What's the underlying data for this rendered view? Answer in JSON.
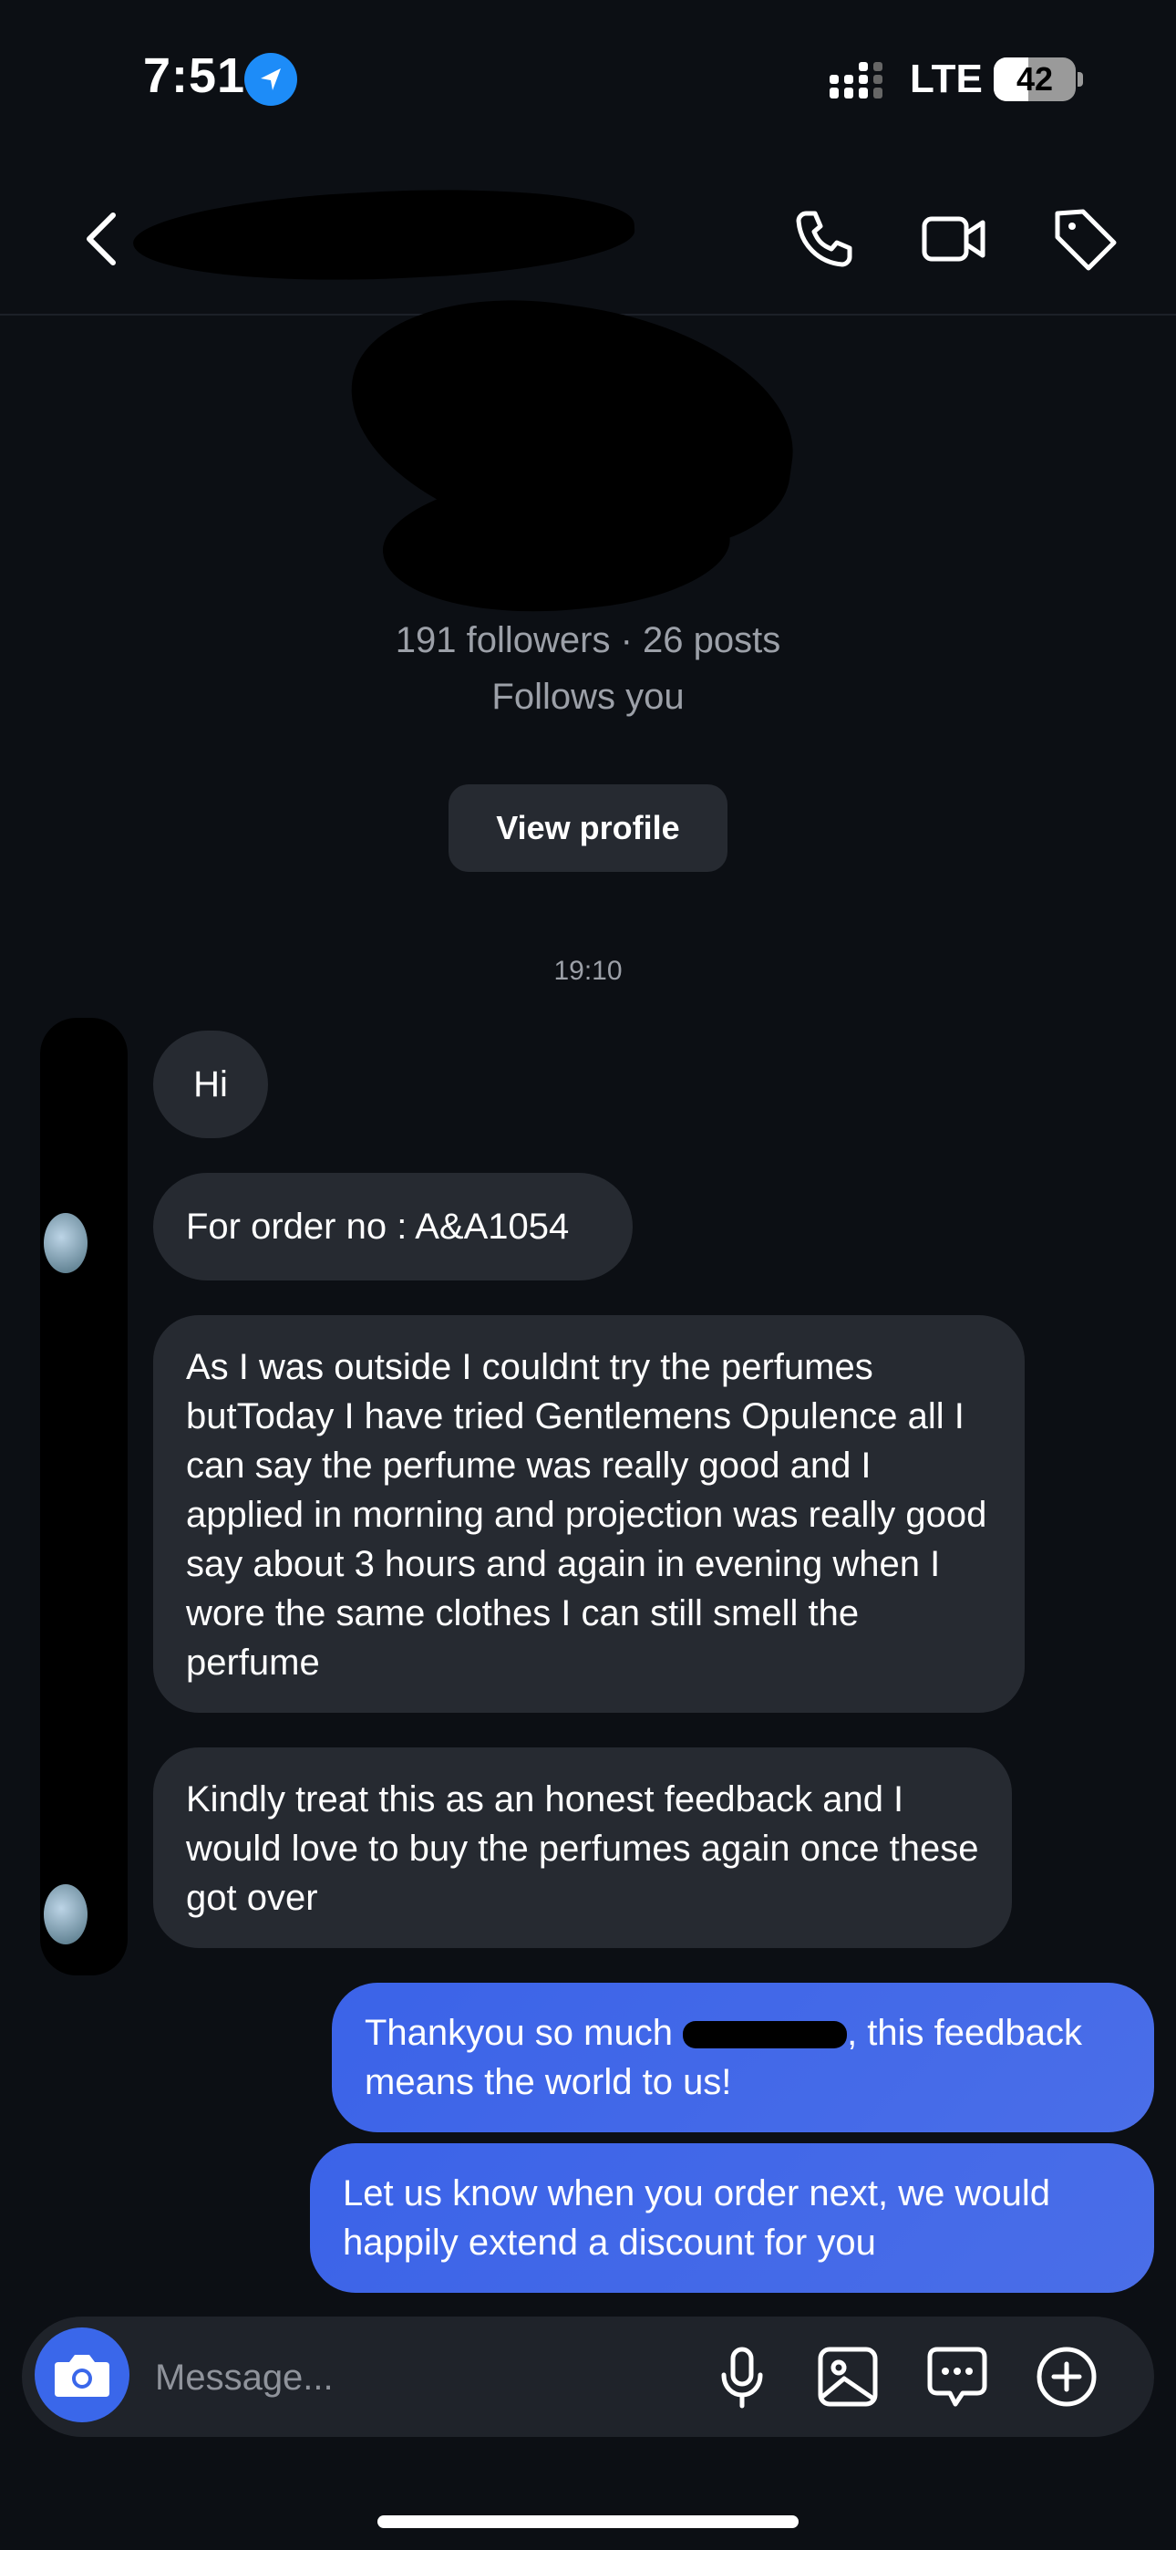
{
  "status_bar": {
    "time": "7:51",
    "network": "LTE",
    "battery": "42",
    "battery_level": 0.42
  },
  "profile": {
    "stats": "191 followers · 26 posts",
    "follows_you": "Follows you",
    "view_profile_label": "View profile"
  },
  "thread": {
    "timestamp": "19:10",
    "messages": [
      {
        "from": "them",
        "text": "Hi"
      },
      {
        "from": "them",
        "text": "For order no : A&A1054"
      },
      {
        "from": "them",
        "text": "As I was outside I couldnt try the perfumes butToday I have tried Gentlemens Opulence all I can say the perfume was really good and I applied in morning and projection was really good say about 3 hours and again in evening when I wore the same clothes I can still smell the perfume"
      },
      {
        "from": "them",
        "text": "Kindly treat this as an honest feedback and I would love to buy the perfumes again once these got over"
      },
      {
        "from": "me",
        "text_before": "Thankyou so much ",
        "text_after": ", this feedback means the world to us!"
      },
      {
        "from": "me",
        "text": "Let us know when you order next, we would happily extend a discount for you"
      }
    ]
  },
  "composer": {
    "placeholder": "Message..."
  },
  "colors": {
    "background": "#0c0f14",
    "incoming_bubble": "#262a31",
    "outgoing_bubble": "#3b63e8",
    "accent": "#1d8cf8"
  },
  "icons": [
    "location-arrow-icon",
    "signal-icon",
    "battery-icon",
    "back-icon",
    "phone-icon",
    "video-icon",
    "tag-icon",
    "camera-icon",
    "mic-icon",
    "gallery-icon",
    "sticker-icon",
    "plus-icon"
  ]
}
